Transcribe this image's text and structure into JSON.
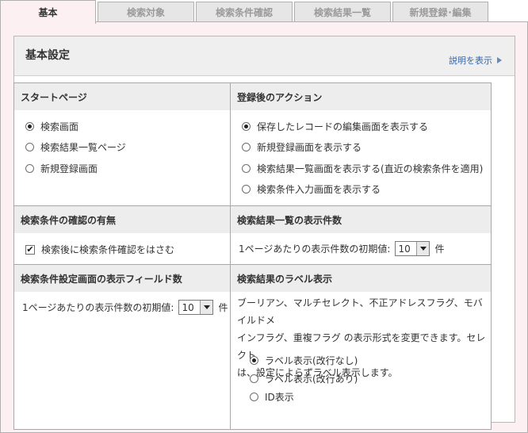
{
  "tabs": [
    {
      "label": "基本",
      "active": true
    },
    {
      "label": "検索対象",
      "active": false
    },
    {
      "label": "検索条件確認",
      "active": false
    },
    {
      "label": "検索結果一覧",
      "active": false
    },
    {
      "label": "新規登録･編集",
      "active": false
    }
  ],
  "panel": {
    "title": "基本設定",
    "help_link": "説明を表示"
  },
  "sections": {
    "start_page": {
      "title": "スタートページ",
      "options": [
        {
          "label": "検索画面",
          "checked": true
        },
        {
          "label": "検索結果一覧ページ",
          "checked": false
        },
        {
          "label": "新規登録画面",
          "checked": false
        }
      ]
    },
    "after_register": {
      "title": "登録後のアクション",
      "options": [
        {
          "label": "保存したレコードの編集画面を表示する",
          "checked": true
        },
        {
          "label": "新規登録画面を表示する",
          "checked": false
        },
        {
          "label": "検索結果一覧画面を表示する(直近の検索条件を適用)",
          "checked": false
        },
        {
          "label": "検索条件入力画面を表示する",
          "checked": false
        }
      ]
    },
    "confirm": {
      "title": "検索条件の確認の有無",
      "checkbox_label": "検索後に検索条件確認をはさむ",
      "checked": true
    },
    "result_count": {
      "title": "検索結果一覧の表示件数",
      "prefix": "1ページあたりの表示件数の初期値:",
      "value": "10",
      "suffix": "件"
    },
    "field_count": {
      "title": "検索条件設定画面の表示フィールド数",
      "prefix": "1ページあたりの表示件数の初期値:",
      "value": "10",
      "suffix": "件"
    },
    "label_display": {
      "title": "検索結果のラベル表示",
      "description_lines": [
        "ブーリアン、マルチセレクト、不正アドレスフラグ、モバイルドメ",
        "インフラグ、重複フラグ の表示形式を変更できます。セレクト",
        "は、設定によらずラベル表示します。"
      ],
      "options": [
        {
          "label": "ラベル表示(改行なし)",
          "checked": true
        },
        {
          "label": "ラベル表示(改行あり)",
          "checked": false
        },
        {
          "label": "ID表示",
          "checked": false
        }
      ]
    }
  }
}
